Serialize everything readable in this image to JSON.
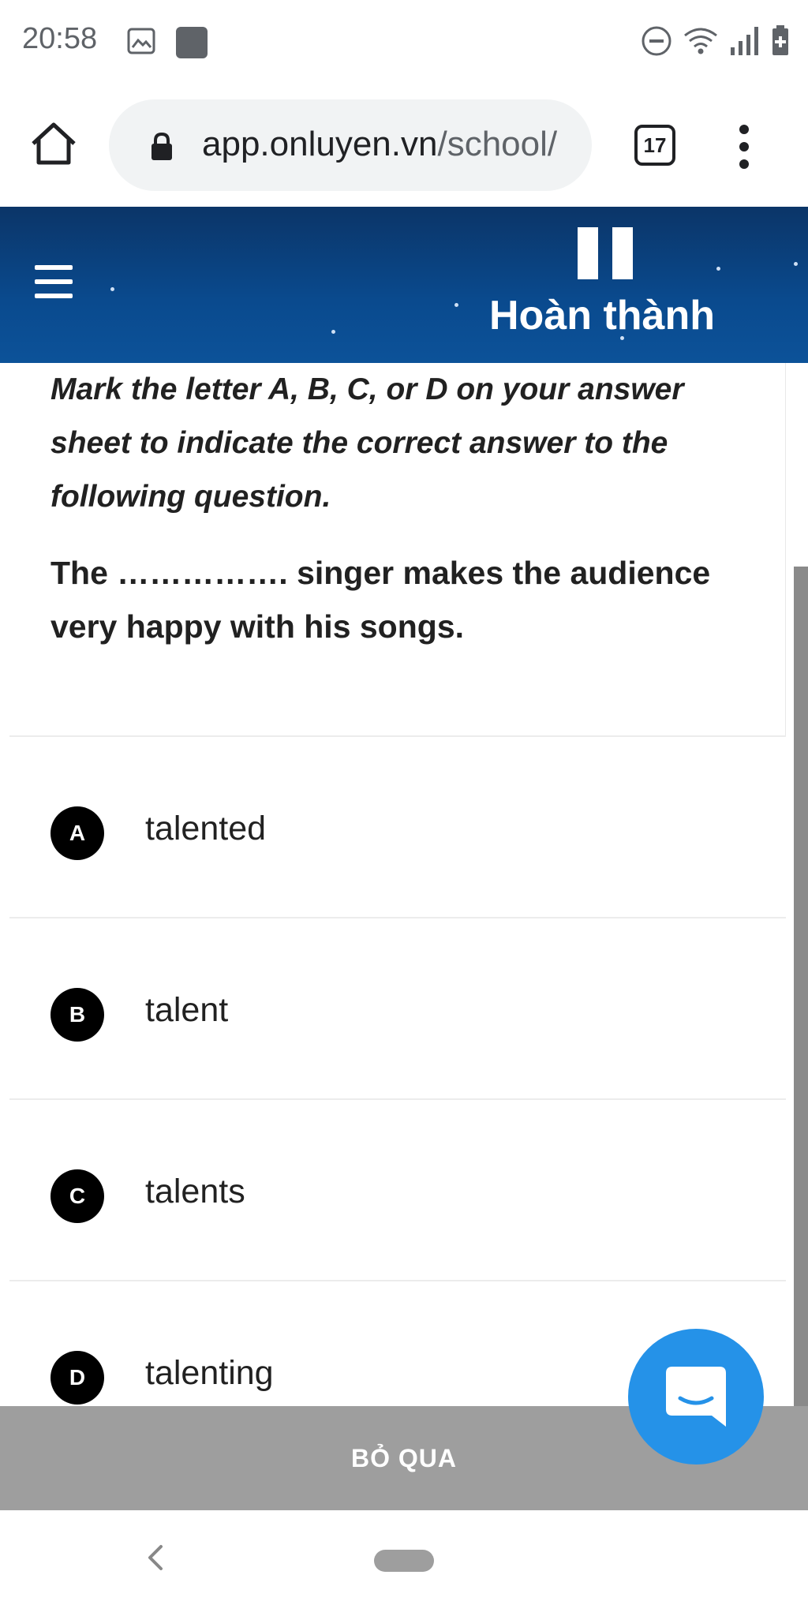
{
  "status_bar": {
    "time": "20:58",
    "left_icons": [
      "image-icon",
      "app-square-icon"
    ],
    "right_icons": [
      "dnd-icon",
      "wifi-icon",
      "signal-icon",
      "battery-icon"
    ]
  },
  "browser": {
    "url_domain": "app.onluyen.vn",
    "url_path": "/school/",
    "tab_count": "17",
    "icons": [
      "home-icon",
      "lock-icon",
      "more-vert-icon"
    ]
  },
  "header": {
    "finish_label": "Hoàn thành",
    "icons": [
      "menu-icon",
      "pause-icon"
    ],
    "colors": {
      "top": "#0b3568",
      "bottom": "#0c5299"
    }
  },
  "question": {
    "instruction": "Mark the letter A, B, C, or D on your answer sheet to indicate the correct answer to the following question.",
    "text": "The ……………. singer makes the audience very happy with his songs."
  },
  "options": [
    {
      "letter": "A",
      "text": "talented"
    },
    {
      "letter": "B",
      "text": "talent"
    },
    {
      "letter": "C",
      "text": "talents"
    },
    {
      "letter": "D",
      "text": "talenting"
    }
  ],
  "skip": {
    "label": "BỎ QUA"
  },
  "chat": {
    "icon": "chat-icon",
    "color": "#2592e8"
  },
  "nav": {
    "icons": [
      "back-icon",
      "home-pill-icon"
    ]
  }
}
